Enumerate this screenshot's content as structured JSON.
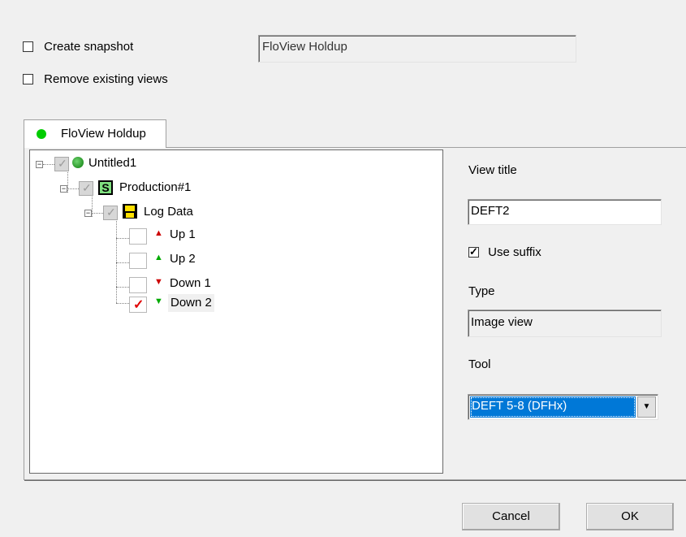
{
  "options": {
    "create_snapshot": {
      "label": "Create snapshot",
      "checked": false
    },
    "remove_existing_views": {
      "label": "Remove existing views",
      "checked": false
    },
    "snapshot_name": "FloView Holdup"
  },
  "tab": {
    "label": "FloView Holdup",
    "status_color": "#00cc00"
  },
  "tree": {
    "root": {
      "label": "Untitled1",
      "icon": "globe-icon"
    },
    "production": {
      "label": "Production#1",
      "icon": "s-box-icon"
    },
    "logdata": {
      "label": "Log Data",
      "icon": "floppy-disk-icon"
    },
    "items": [
      {
        "label": "Up 1",
        "arrow": "up",
        "color": "#cc0000",
        "checked": false
      },
      {
        "label": "Up 2",
        "arrow": "up",
        "color": "#00aa00",
        "checked": false
      },
      {
        "label": "Down 1",
        "arrow": "down",
        "color": "#cc0000",
        "checked": false
      },
      {
        "label": "Down 2",
        "arrow": "down",
        "color": "#00aa00",
        "checked": true
      }
    ]
  },
  "right_panel": {
    "view_title_label": "View title",
    "view_title_value": "DEFT2",
    "use_suffix_label": "Use suffix",
    "use_suffix_checked": true,
    "type_label": "Type",
    "type_value": "Image view",
    "tool_label": "Tool",
    "tool_value": "DEFT 5-8 (DFHx)"
  },
  "buttons": {
    "cancel": "Cancel",
    "ok": "OK"
  }
}
